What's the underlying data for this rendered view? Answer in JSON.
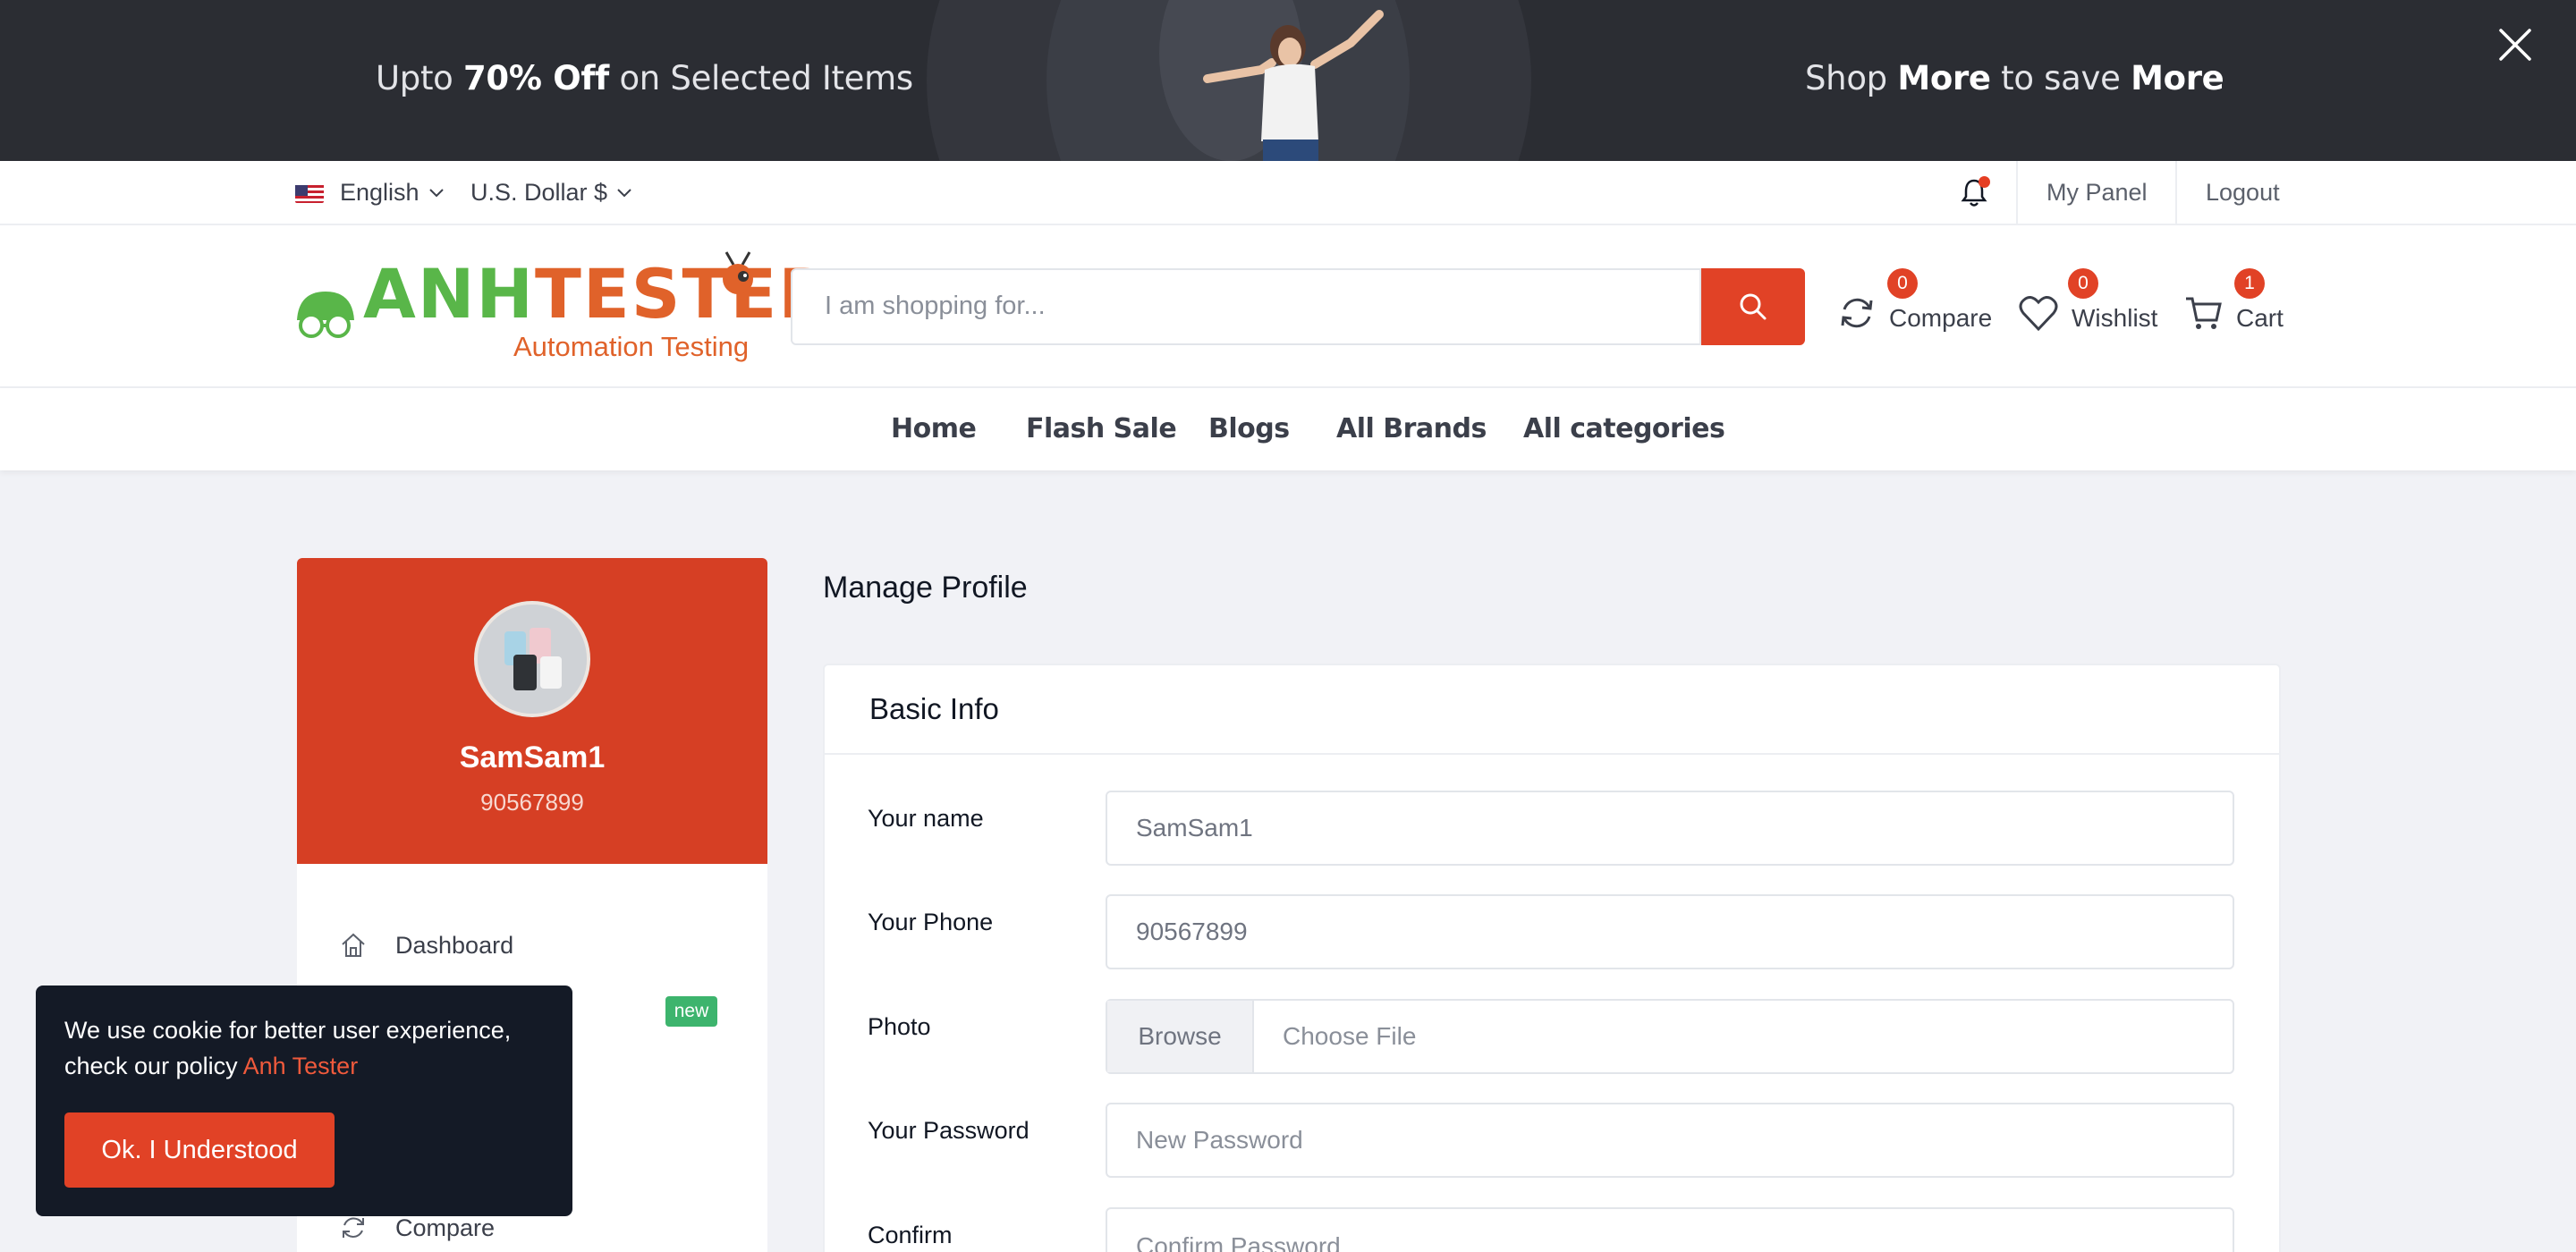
{
  "banner": {
    "left_pre": "Upto ",
    "left_bold": "70% Off",
    "left_post": " on Selected Items",
    "right_pre": "Shop ",
    "right_bold1": "More",
    "right_mid": " to save ",
    "right_bold2": "More",
    "close_icon": "close-icon"
  },
  "topbar": {
    "language": "English",
    "currency": "U.S. Dollar $",
    "my_panel": "My Panel",
    "logout": "Logout",
    "notification_icon": "bell-icon"
  },
  "header": {
    "logo_text_1": "ANH",
    "logo_text_2": "TESTER",
    "logo_sub": "Automation Testing",
    "search_placeholder": "I am shopping for...",
    "compare": {
      "label": "Compare",
      "count": "0"
    },
    "wishlist": {
      "label": "Wishlist",
      "count": "0"
    },
    "cart": {
      "label": "Cart",
      "count": "1"
    }
  },
  "nav": {
    "items": [
      "Home",
      "Flash Sale",
      "Blogs",
      "All Brands",
      "All categories"
    ]
  },
  "sidebar": {
    "username": "SamSam1",
    "phone": "90567899",
    "items": [
      {
        "label": "Dashboard",
        "icon": "home-icon"
      },
      {
        "label": "Compare",
        "icon": "refresh-icon"
      }
    ],
    "new_badge": "new"
  },
  "main": {
    "title": "Manage Profile",
    "card_title": "Basic Info",
    "fields": {
      "name_label": "Your name",
      "name_value": "SamSam1",
      "phone_label": "Your Phone",
      "phone_value": "90567899",
      "photo_label": "Photo",
      "browse_label": "Browse",
      "choose_file": "Choose File",
      "password_label": "Your Password",
      "password_placeholder": "New Password",
      "confirm_label": "Confirm",
      "confirm_placeholder": "Confirm Password"
    }
  },
  "cookie": {
    "text": "We use cookie for better user experience, check our policy ",
    "link": "Anh Tester",
    "button": "Ok. I Understood"
  },
  "colors": {
    "accent": "#e14226",
    "sidebar_header": "#d63f24",
    "logo_green": "#59b649",
    "logo_orange": "#e0622a",
    "new_badge": "#3db46d"
  }
}
